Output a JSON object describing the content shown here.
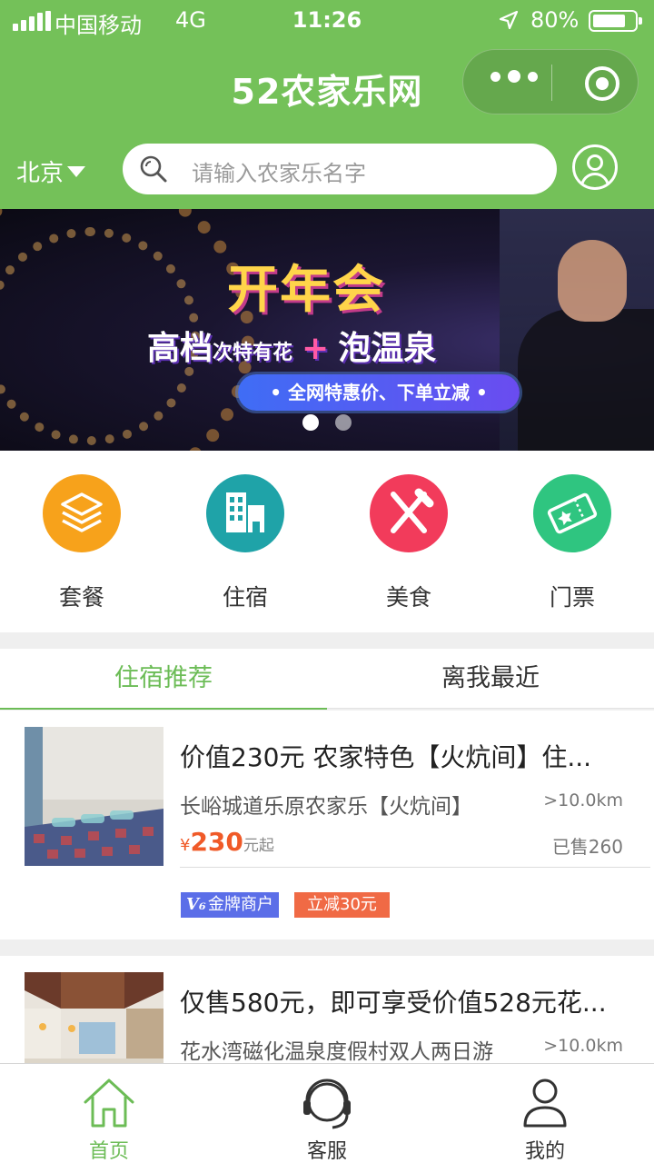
{
  "status_bar": {
    "carrier": "中国移动",
    "network": "4G",
    "time": "11:26",
    "battery": "80%",
    "battery_level": 0.8
  },
  "header": {
    "title": "52农家乐网",
    "city": "北京",
    "search_placeholder": "请输入农家乐名字"
  },
  "banner": {
    "headline": "开年会",
    "line_main": "高档",
    "line_small": "次特有花",
    "line_plus": "+",
    "line_right": "泡温泉",
    "pill": "• 全网特惠价、下单立减 •",
    "active_dot": 0,
    "dot_count": 2
  },
  "categories": [
    {
      "label": "套餐",
      "icon": "layers-icon",
      "color": "#f7a21b"
    },
    {
      "label": "住宿",
      "icon": "building-icon",
      "color": "#1fa3a8"
    },
    {
      "label": "美食",
      "icon": "utensils-icon",
      "color": "#f23b5b"
    },
    {
      "label": "门票",
      "icon": "ticket-icon",
      "color": "#2fc580"
    }
  ],
  "tabs": [
    {
      "label": "住宿推荐",
      "active": true
    },
    {
      "label": "离我最近",
      "active": false
    }
  ],
  "listings": [
    {
      "title": "价值230元 农家特色【火炕间】住...",
      "subtitle": "长峪城道乐原农家乐【火炕间】",
      "distance": ">10.0km",
      "currency": "¥",
      "price": "230",
      "price_suffix": "元起",
      "sold": "已售260",
      "badge_mark": "V₆",
      "badge_text": "金牌商户",
      "discount": "立减30元"
    },
    {
      "title": "仅售580元，即可享受价值528元花...",
      "subtitle": "花水湾磁化温泉度假村双人两日游",
      "distance": ">10.0km"
    }
  ],
  "tabbar": [
    {
      "label": "首页",
      "icon": "home-icon",
      "active": true
    },
    {
      "label": "客服",
      "icon": "headset-icon",
      "active": false
    },
    {
      "label": "我的",
      "icon": "user-icon",
      "active": false
    }
  ],
  "colors": {
    "brand_green": "#74c159",
    "active_green": "#6cbc56",
    "price_orange": "#f05a28",
    "badge_blue": "#5b6ee8",
    "badge_orange": "#f06a45"
  }
}
